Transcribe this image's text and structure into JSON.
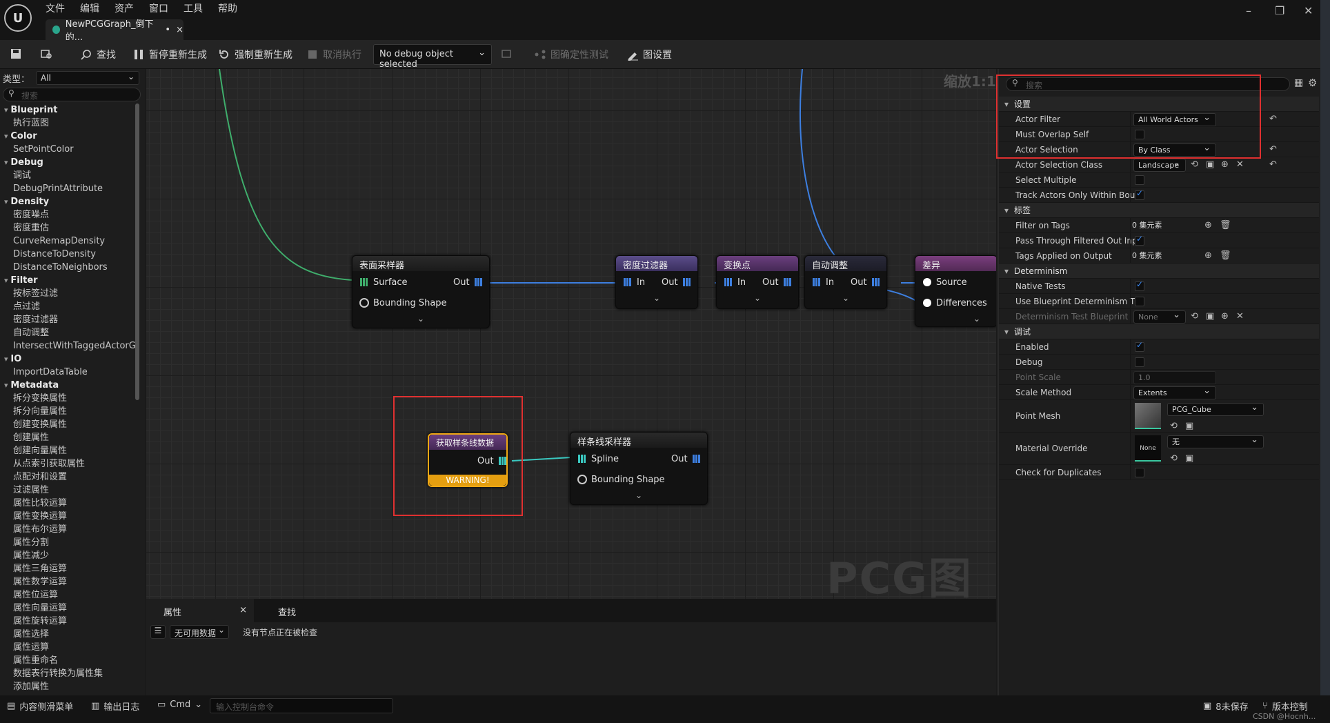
{
  "menu": [
    "文件",
    "编辑",
    "资产",
    "窗口",
    "工具",
    "帮助"
  ],
  "doc_tab": {
    "title": "NewPCGGraph_倒下的...",
    "modified": "•",
    "close": "×"
  },
  "window_controls": {
    "minimize": "–",
    "restore": "❐",
    "close": "✕"
  },
  "toolbar": {
    "find": "查找",
    "pause_regen": "暂停重新生成",
    "force_regen": "强制重新生成",
    "cancel_exec": "取消执行",
    "debug_object": "No debug object selected",
    "determinism_test": "图确定性测试",
    "graph_settings": "图设置"
  },
  "palette": {
    "type_label": "类型：",
    "type_value": "All",
    "search_placeholder": "搜索",
    "items": [
      {
        "t": "cat",
        "label": "Blueprint"
      },
      {
        "t": "item",
        "label": "执行蓝图"
      },
      {
        "t": "cat",
        "label": "Color"
      },
      {
        "t": "item",
        "label": "SetPointColor"
      },
      {
        "t": "cat",
        "label": "Debug"
      },
      {
        "t": "item",
        "label": "调试"
      },
      {
        "t": "item",
        "label": "DebugPrintAttribute"
      },
      {
        "t": "cat",
        "label": "Density"
      },
      {
        "t": "item",
        "label": "密度噪点"
      },
      {
        "t": "item",
        "label": "密度重估"
      },
      {
        "t": "item",
        "label": "CurveRemapDensity"
      },
      {
        "t": "item",
        "label": "DistanceToDensity"
      },
      {
        "t": "item",
        "label": "DistanceToNeighbors"
      },
      {
        "t": "cat",
        "label": "Filter"
      },
      {
        "t": "item",
        "label": "按标签过滤"
      },
      {
        "t": "item",
        "label": "点过滤"
      },
      {
        "t": "item",
        "label": "密度过滤器"
      },
      {
        "t": "item",
        "label": "自动调整"
      },
      {
        "t": "item",
        "label": "IntersectWithTaggedActorGec"
      },
      {
        "t": "cat",
        "label": "IO"
      },
      {
        "t": "item",
        "label": "ImportDataTable"
      },
      {
        "t": "cat",
        "label": "Metadata"
      },
      {
        "t": "item",
        "label": "拆分变换属性"
      },
      {
        "t": "item",
        "label": "拆分向量属性"
      },
      {
        "t": "item",
        "label": "创建变换属性"
      },
      {
        "t": "item",
        "label": "创建属性"
      },
      {
        "t": "item",
        "label": "创建向量属性"
      },
      {
        "t": "item",
        "label": "从点索引获取属性"
      },
      {
        "t": "item",
        "label": "点配对和设置"
      },
      {
        "t": "item",
        "label": "过滤属性"
      },
      {
        "t": "item",
        "label": "属性比较运算"
      },
      {
        "t": "item",
        "label": "属性变换运算"
      },
      {
        "t": "item",
        "label": "属性布尔运算"
      },
      {
        "t": "item",
        "label": "属性分割"
      },
      {
        "t": "item",
        "label": "属性减少"
      },
      {
        "t": "item",
        "label": "属性三角运算"
      },
      {
        "t": "item",
        "label": "属性数学运算"
      },
      {
        "t": "item",
        "label": "属性位运算"
      },
      {
        "t": "item",
        "label": "属性向量运算"
      },
      {
        "t": "item",
        "label": "属性旋转运算"
      },
      {
        "t": "item",
        "label": "属性选择"
      },
      {
        "t": "item",
        "label": "属性运算"
      },
      {
        "t": "item",
        "label": "属性重命名"
      },
      {
        "t": "item",
        "label": "数据表行转换为属性集"
      },
      {
        "t": "item",
        "label": "添加属性"
      }
    ]
  },
  "graph": {
    "zoom": "缩放1:1",
    "watermark": "PCG图表",
    "nodes": {
      "surface_sampler": {
        "title": "表面采样器",
        "pin1": "Surface",
        "pin2": "Bounding Shape",
        "out": "Out"
      },
      "density_filter": {
        "title": "密度过滤器",
        "in": "In",
        "out": "Out"
      },
      "transform_points": {
        "title": "变换点",
        "in": "In",
        "out": "Out"
      },
      "self_pruning": {
        "title": "自动调整",
        "in": "In",
        "out": "Out"
      },
      "difference": {
        "title": "差异",
        "pin1": "Source",
        "pin2": "Differences"
      },
      "get_spline": {
        "title": "获取样条线数据",
        "out": "Out",
        "warning": "WARNING!"
      },
      "spline_sampler": {
        "title": "样条线采样器",
        "pin1": "Spline",
        "pin2": "Bounding Shape",
        "out": "Out"
      }
    }
  },
  "bottom_panel": {
    "tab_properties": "属性",
    "tab_close": "×",
    "tab_find": "查找",
    "filter_value": "无可用数据",
    "message": "没有节点正在被检查"
  },
  "statusbar": {
    "content_drawer": "内容侧滑菜单",
    "output_log": "输出日志",
    "cmd": "Cmd",
    "console_placeholder": "输入控制台命令",
    "unsaved": "8未保存",
    "source_control": "版本控制"
  },
  "details": {
    "search_placeholder": "搜索",
    "rows": [
      {
        "k": "cat",
        "label": "设置"
      },
      {
        "k": "dd",
        "label": "Actor Filter",
        "value": "All World Actors",
        "reset": true
      },
      {
        "k": "chk",
        "label": "Must Overlap Self",
        "checked": false
      },
      {
        "k": "dd",
        "label": "Actor Selection",
        "value": "By Class",
        "reset": true
      },
      {
        "k": "cls",
        "label": "Actor Selection Class",
        "value": "Landscape",
        "reset": true
      },
      {
        "k": "chk",
        "label": "Select Multiple",
        "checked": false
      },
      {
        "k": "chk",
        "label": "Track Actors Only Within Bou...",
        "checked": true
      },
      {
        "k": "cat",
        "label": "标签"
      },
      {
        "k": "arr",
        "label": "Filter on Tags",
        "value": "0 集元素"
      },
      {
        "k": "chk",
        "label": "Pass Through Filtered Out Inp...",
        "checked": true
      },
      {
        "k": "arr",
        "label": "Tags Applied on Output",
        "value": "0 集元素"
      },
      {
        "k": "cat",
        "label": "Determinism"
      },
      {
        "k": "chk",
        "label": "Native Tests",
        "checked": true
      },
      {
        "k": "chk",
        "label": "Use Blueprint Determinism T...",
        "checked": false
      },
      {
        "k": "clsdim",
        "label": "Determinism Test Blueprint",
        "value": "None"
      },
      {
        "k": "cat",
        "label": "调试"
      },
      {
        "k": "chk",
        "label": "Enabled",
        "checked": true
      },
      {
        "k": "chk",
        "label": "Debug",
        "checked": false
      },
      {
        "k": "num",
        "label": "Point Scale",
        "value": "1.0"
      },
      {
        "k": "dd",
        "label": "Scale Method",
        "value": "Extents"
      },
      {
        "k": "mesh",
        "label": "Point Mesh",
        "value": "PCG_Cube"
      },
      {
        "k": "mat",
        "label": "Material Override",
        "value": "无",
        "thumb": "None"
      },
      {
        "k": "chk",
        "label": "Check for Duplicates",
        "checked": false
      }
    ]
  },
  "colors": {
    "accent": "#3d8fff",
    "highlight_box": "#e03030",
    "warning": "#e49e10",
    "wire_green": "#3fae6c",
    "wire_blue": "#3d7fe0"
  },
  "watermark_text": "CSDN @Hocnh..."
}
